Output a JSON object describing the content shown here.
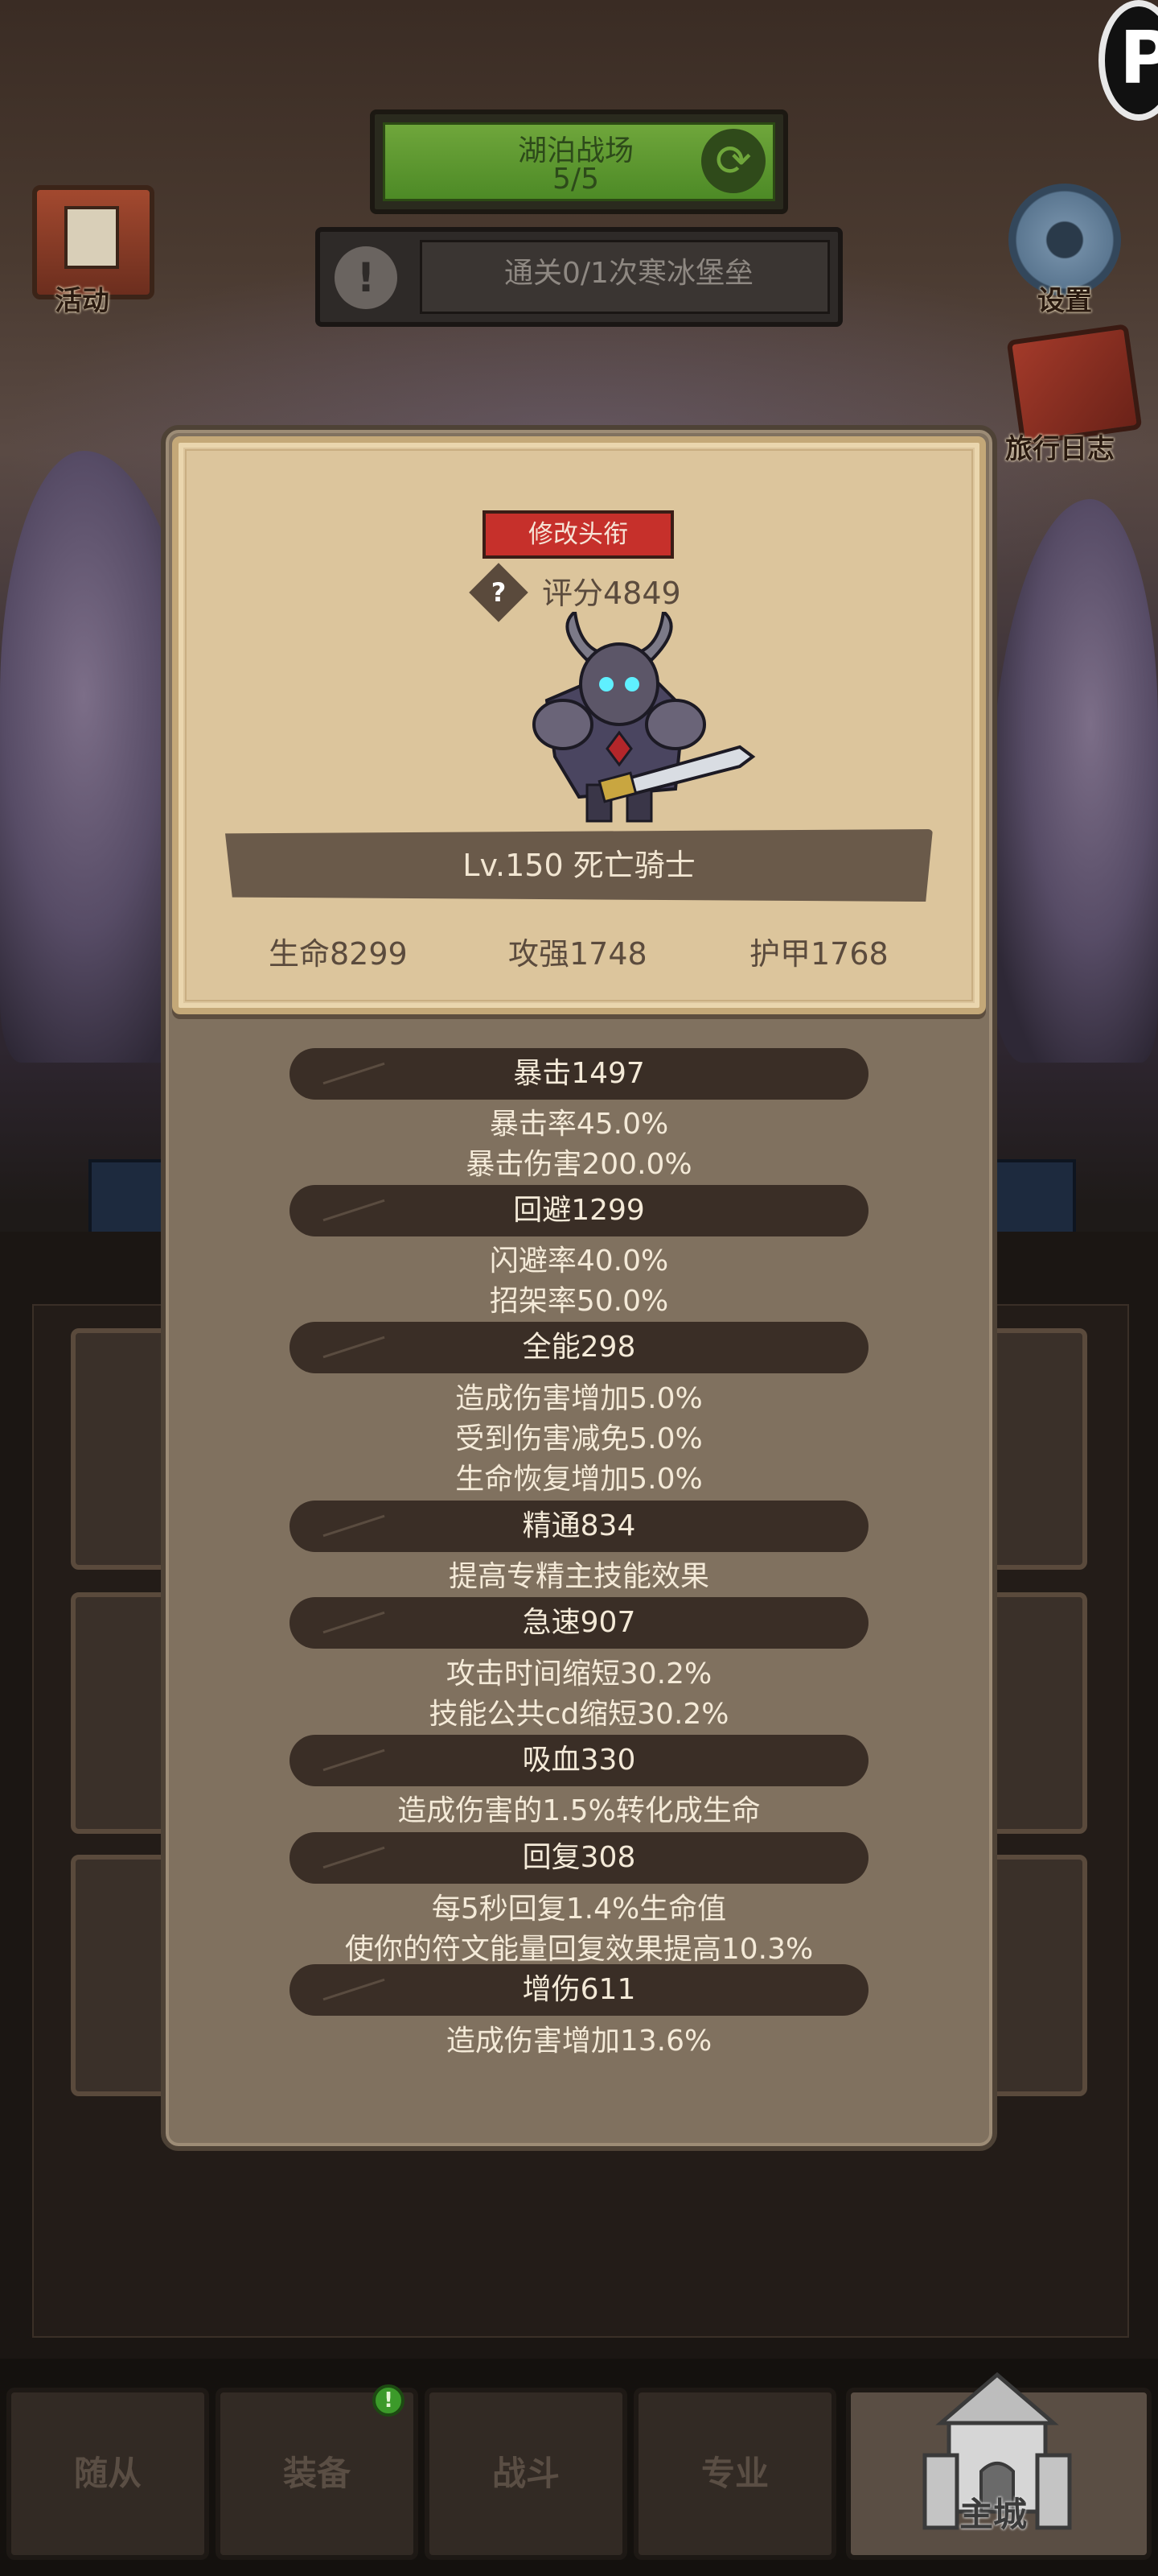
{
  "hud": {
    "activity_label": "活动",
    "battlefield_name": "湖泊战场",
    "battlefield_progress": "5/5",
    "quest_text": "通关0/1次寒冰堡垒",
    "settings_label": "设置",
    "journal_label": "旅行日志",
    "corner_glyph": "P"
  },
  "character": {
    "rename_button": "修改头衔",
    "score": "评分4849",
    "name": "Lv.150 死亡骑士",
    "stats": {
      "hp": "生命8299",
      "attack": "攻强1748",
      "armor": "护甲1768"
    }
  },
  "attributes": [
    {
      "title": "暴击1497",
      "lines": [
        "暴击率45.0%",
        "暴击伤害200.0%"
      ]
    },
    {
      "title": "回避1299",
      "lines": [
        "闪避率40.0%",
        "招架率50.0%"
      ]
    },
    {
      "title": "全能298",
      "lines": [
        "造成伤害增加5.0%",
        "受到伤害减免5.0%",
        "生命恢复增加5.0%"
      ]
    },
    {
      "title": "精通834",
      "lines": [
        "提高专精主技能效果"
      ]
    },
    {
      "title": "急速907",
      "lines": [
        "攻击时间缩短30.2%",
        "技能公共cd缩短30.2%"
      ]
    },
    {
      "title": "吸血330",
      "lines": [
        "造成伤害的1.5%转化成生命"
      ]
    },
    {
      "title": "回复308",
      "lines": [
        "每5秒回复1.4%生命值",
        "使你的符文能量回复效果提高10.3%"
      ]
    },
    {
      "title": "增伤611",
      "lines": [
        "造成伤害增加13.6%"
      ]
    }
  ],
  "nav": {
    "tabs": [
      "随从",
      "装备",
      "战斗",
      "专业"
    ],
    "home": "主城",
    "equipment_badge": "!"
  },
  "colors": {
    "panel": "#80715f",
    "parchment": "#dcc59c",
    "banner": "#3a2e26",
    "rename": "#c6302b",
    "battlefield_green": "#6fa63b"
  }
}
